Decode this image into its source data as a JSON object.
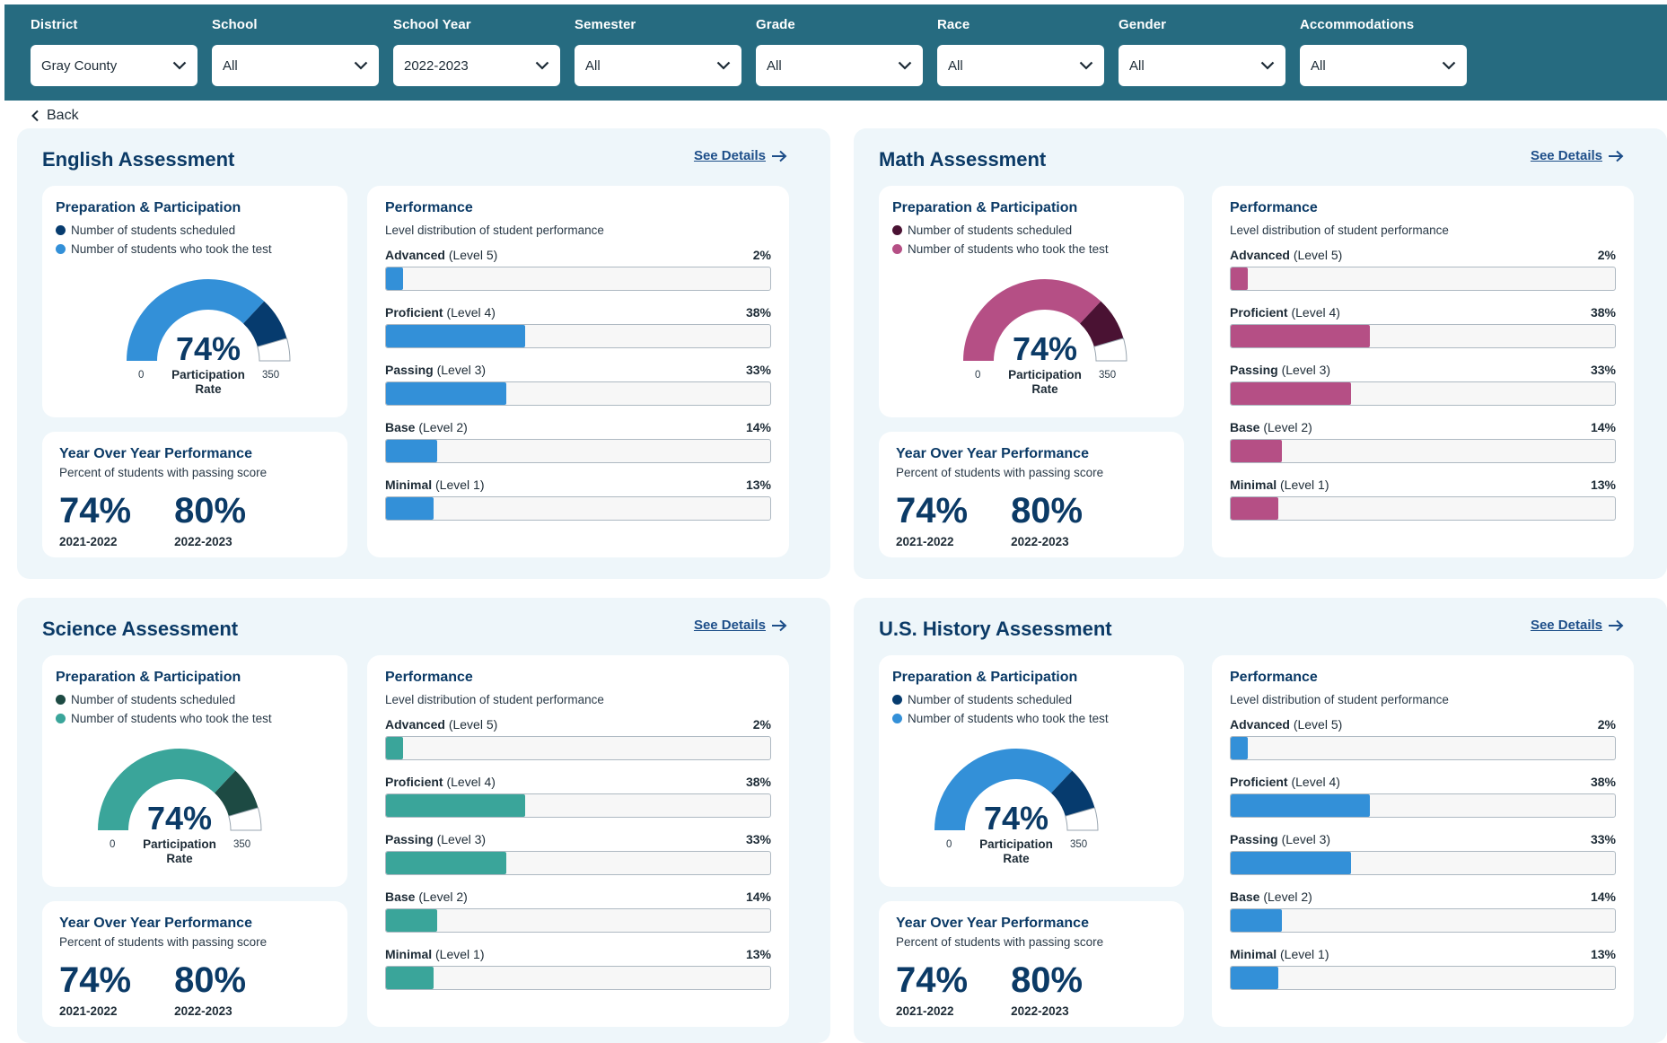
{
  "filters": [
    {
      "label": "District",
      "value": "Gray County"
    },
    {
      "label": "School",
      "value": "All"
    },
    {
      "label": "School Year",
      "value": "2022-2023"
    },
    {
      "label": "Semester",
      "value": "All"
    },
    {
      "label": "Grade",
      "value": "All"
    },
    {
      "label": "Race",
      "value": "All"
    },
    {
      "label": "Gender",
      "value": "All"
    },
    {
      "label": "Accommodations",
      "value": "All"
    }
  ],
  "back_label": "Back",
  "see_details_label": "See Details",
  "prep_title": "Preparation & Participation",
  "legend_scheduled": "Number of students scheduled",
  "legend_took": "Number of students who took the test",
  "gauge_caption_line1": "Participation",
  "gauge_caption_line2": "Rate",
  "gauge_min": "0",
  "gauge_max": "350",
  "yoy_title": "Year Over Year Performance",
  "yoy_subtitle": "Percent of students with passing score",
  "perf_title": "Performance",
  "perf_subtitle": "Level distribution of student performance",
  "assessments": [
    {
      "title": "English Assessment",
      "colors": {
        "dark": "#063b6e",
        "light": "#3390d8"
      },
      "participation_pct": "74%",
      "participation_fraction": 0.74,
      "yoy": [
        {
          "value": "74%",
          "year": "2021-2022"
        },
        {
          "value": "80%",
          "year": "2022-2023"
        }
      ],
      "levels": [
        {
          "name": "Advanced",
          "level": "(Level 5)",
          "pct": "2%",
          "value": 2
        },
        {
          "name": "Proficient",
          "level": "(Level 4)",
          "pct": "38%",
          "value": 38
        },
        {
          "name": "Passing",
          "level": "(Level 3)",
          "pct": "33%",
          "value": 33
        },
        {
          "name": "Base",
          "level": "(Level 2)",
          "pct": "14%",
          "value": 14
        },
        {
          "name": "Minimal",
          "level": "(Level 1)",
          "pct": "13%",
          "value": 13
        }
      ]
    },
    {
      "title": "Math Assessment",
      "colors": {
        "dark": "#4a1233",
        "light": "#b54f85"
      },
      "participation_pct": "74%",
      "participation_fraction": 0.74,
      "yoy": [
        {
          "value": "74%",
          "year": "2021-2022"
        },
        {
          "value": "80%",
          "year": "2022-2023"
        }
      ],
      "levels": [
        {
          "name": "Advanced",
          "level": "(Level 5)",
          "pct": "2%",
          "value": 2
        },
        {
          "name": "Proficient",
          "level": "(Level 4)",
          "pct": "38%",
          "value": 38
        },
        {
          "name": "Passing",
          "level": "(Level 3)",
          "pct": "33%",
          "value": 33
        },
        {
          "name": "Base",
          "level": "(Level 2)",
          "pct": "14%",
          "value": 14
        },
        {
          "name": "Minimal",
          "level": "(Level 1)",
          "pct": "13%",
          "value": 13
        }
      ]
    },
    {
      "title": "Science Assessment",
      "colors": {
        "dark": "#1d4a43",
        "light": "#3aa59a"
      },
      "participation_pct": "74%",
      "participation_fraction": 0.74,
      "yoy": [
        {
          "value": "74%",
          "year": "2021-2022"
        },
        {
          "value": "80%",
          "year": "2022-2023"
        }
      ],
      "levels": [
        {
          "name": "Advanced",
          "level": "(Level 5)",
          "pct": "2%",
          "value": 2
        },
        {
          "name": "Proficient",
          "level": "(Level 4)",
          "pct": "38%",
          "value": 38
        },
        {
          "name": "Passing",
          "level": "(Level 3)",
          "pct": "33%",
          "value": 33
        },
        {
          "name": "Base",
          "level": "(Level 2)",
          "pct": "14%",
          "value": 14
        },
        {
          "name": "Minimal",
          "level": "(Level 1)",
          "pct": "13%",
          "value": 13
        }
      ]
    },
    {
      "title": "U.S. History Assessment",
      "colors": {
        "dark": "#063b6e",
        "light": "#3390d8"
      },
      "participation_pct": "74%",
      "participation_fraction": 0.74,
      "yoy": [
        {
          "value": "74%",
          "year": "2021-2022"
        },
        {
          "value": "80%",
          "year": "2022-2023"
        }
      ],
      "levels": [
        {
          "name": "Advanced",
          "level": "(Level 5)",
          "pct": "2%",
          "value": 2
        },
        {
          "name": "Proficient",
          "level": "(Level 4)",
          "pct": "38%",
          "value": 38
        },
        {
          "name": "Passing",
          "level": "(Level 3)",
          "pct": "33%",
          "value": 33
        },
        {
          "name": "Base",
          "level": "(Level 2)",
          "pct": "14%",
          "value": 14
        },
        {
          "name": "Minimal",
          "level": "(Level 1)",
          "pct": "13%",
          "value": 13
        }
      ]
    }
  ]
}
